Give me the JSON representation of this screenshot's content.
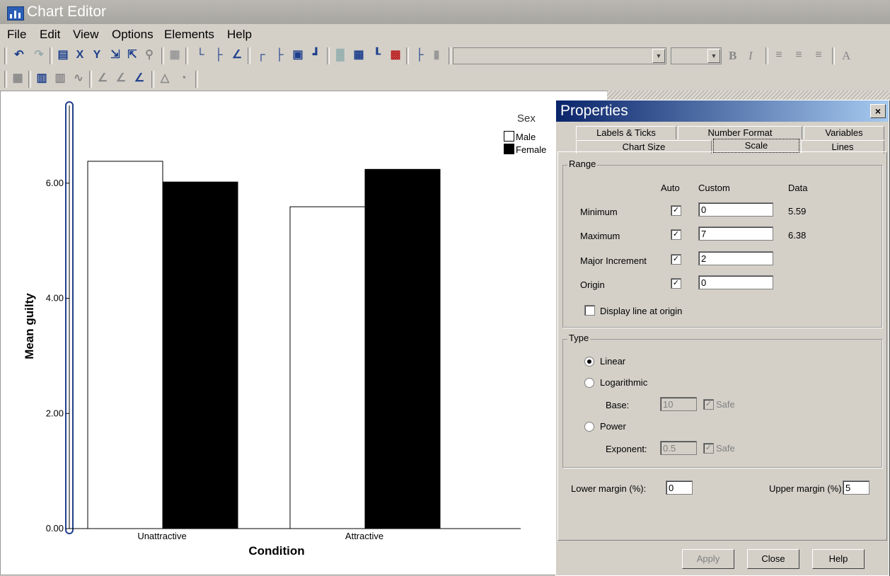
{
  "window": {
    "title": "Chart Editor"
  },
  "menu": [
    "File",
    "Edit",
    "View",
    "Options",
    "Elements",
    "Help"
  ],
  "format": {
    "bold": "B",
    "italic": "I",
    "text_tool": "A"
  },
  "chart_data": {
    "type": "bar",
    "categories": [
      "Unattractive",
      "Attractive"
    ],
    "series": [
      {
        "name": "Male",
        "values": [
          6.38,
          5.59
        ],
        "color": "#ffffff"
      },
      {
        "name": "Female",
        "values": [
          6.02,
          6.24
        ],
        "color": "#000000"
      }
    ],
    "legend_title": "Sex",
    "xlabel": "Condition",
    "ylabel": "Mean guilty",
    "ylim": [
      0,
      7.35
    ],
    "yticks": [
      "0.00",
      "2.00",
      "4.00",
      "6.00"
    ],
    "ytick_values": [
      0,
      2,
      4,
      6
    ],
    "legend_position": "top-right"
  },
  "dialog": {
    "title": "Properties",
    "close": "×",
    "tabs_row1": [
      "Labels & Ticks",
      "Number Format",
      "Variables"
    ],
    "tabs_row2": [
      "Chart Size",
      "Scale",
      "Lines"
    ],
    "range": {
      "label": "Range",
      "headers": {
        "auto": "Auto",
        "custom": "Custom",
        "data": "Data"
      },
      "rows": [
        {
          "label": "Minimum",
          "auto": true,
          "custom": "0",
          "data": "5.59"
        },
        {
          "label": "Maximum",
          "auto": true,
          "custom": "7",
          "data": "6.38"
        },
        {
          "label": "Major Increment",
          "auto": true,
          "custom": "2",
          "data": ""
        },
        {
          "label": "Origin",
          "auto": true,
          "custom": "0",
          "data": ""
        }
      ],
      "display_line": "Display line at origin"
    },
    "type": {
      "label": "Type",
      "linear": "Linear",
      "log": "Logarithmic",
      "base_label": "Base:",
      "base_value": "10",
      "safe": "Safe",
      "power": "Power",
      "exponent_label": "Exponent:",
      "exponent_value": "0.5"
    },
    "margins": {
      "lower_label": "Lower margin (%):",
      "lower_value": "0",
      "upper_label": "Upper margin (%):",
      "upper_value": "5"
    },
    "buttons": {
      "apply": "Apply",
      "close": "Close",
      "help": "Help"
    }
  }
}
